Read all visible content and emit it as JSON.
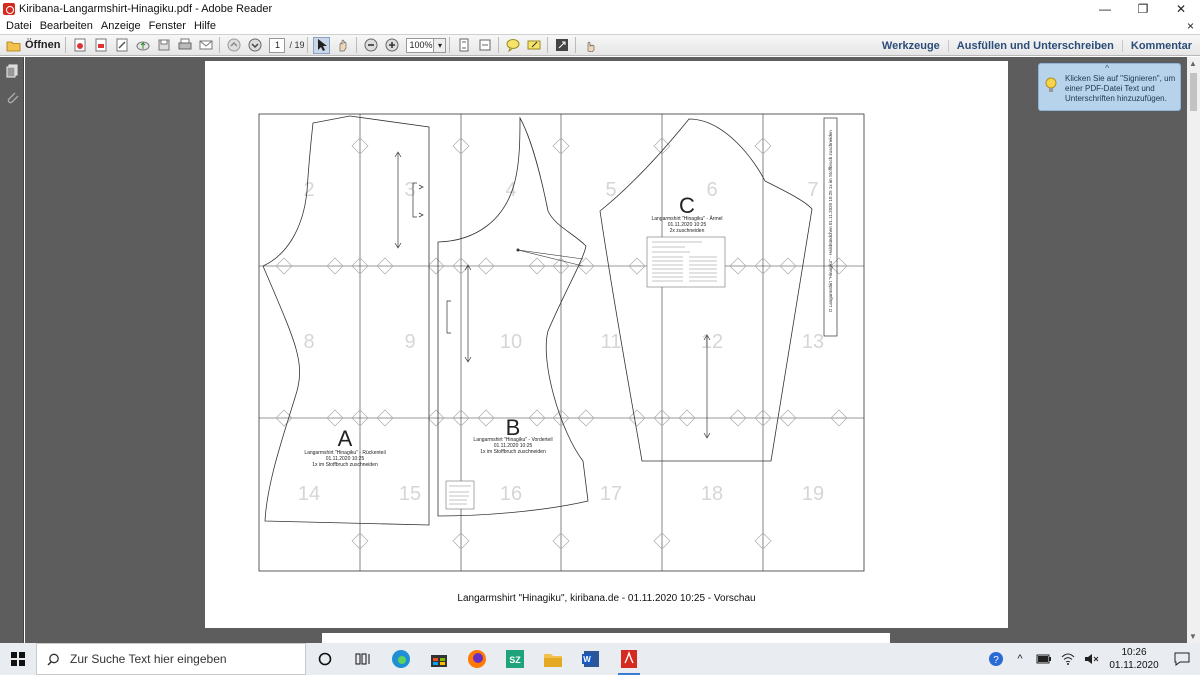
{
  "window": {
    "title": "Kiribana-Langarmshirt-Hinagiku.pdf - Adobe Reader",
    "minimize": "—",
    "maximize": "❐",
    "close": "✕",
    "doc_close": "×"
  },
  "menu": {
    "items": [
      "Datei",
      "Bearbeiten",
      "Anzeige",
      "Fenster",
      "Hilfe"
    ]
  },
  "toolbar": {
    "open_label": "Öffnen",
    "current_page": "1",
    "total_pages": "/ 19",
    "zoom": "100%",
    "right_links": [
      "Werkzeuge",
      "Ausfüllen und Unterschreiben",
      "Kommentar"
    ]
  },
  "tooltip": {
    "text": "Klicken Sie auf \"Signieren\", um einer PDF-Datei Text und Unterschriften hinzuzufügen."
  },
  "document": {
    "footer": "Langarmshirt \"Hinagiku\", kiribana.de - 01.11.2020 10:25 - Vorschau",
    "tile_numbers": [
      "2",
      "3",
      "4",
      "5",
      "6",
      "7",
      "8",
      "9",
      "10",
      "11",
      "12",
      "13",
      "14",
      "15",
      "16",
      "17",
      "18",
      "19"
    ],
    "pieces": [
      {
        "letter": "A",
        "line1": "Langarmshirt \"Hinagiku\" - Rückenteil",
        "line2": "01.11.2020 10:25",
        "line3": "1x im Stoffbruch zuschneiden"
      },
      {
        "letter": "B",
        "line1": "Langarmshirt \"Hinagiku\" - Vorderteil",
        "line2": "01.11.2020 10:25",
        "line3": "1x im Stoffbruch zuschneiden"
      },
      {
        "letter": "C",
        "line1": "Langarmshirt \"Hinagiku\" - Ärmel",
        "line2": "01.11.2020 10:25",
        "line3": "2x zuschneiden"
      }
    ],
    "strip_label": "D Langarmshirt \"Hinagiku\" - Halsbündchen 01.11.2020 10:25 1x im Stoffbruch zuschneiden"
  },
  "taskbar": {
    "search_placeholder": "Zur Suche Text hier eingeben",
    "time": "10:26",
    "date": "01.11.2020"
  },
  "colors": {
    "workspace": "#5d5d5d",
    "accent_link": "#2b4d7a",
    "tooltip_bg": "#b7d3ec"
  }
}
